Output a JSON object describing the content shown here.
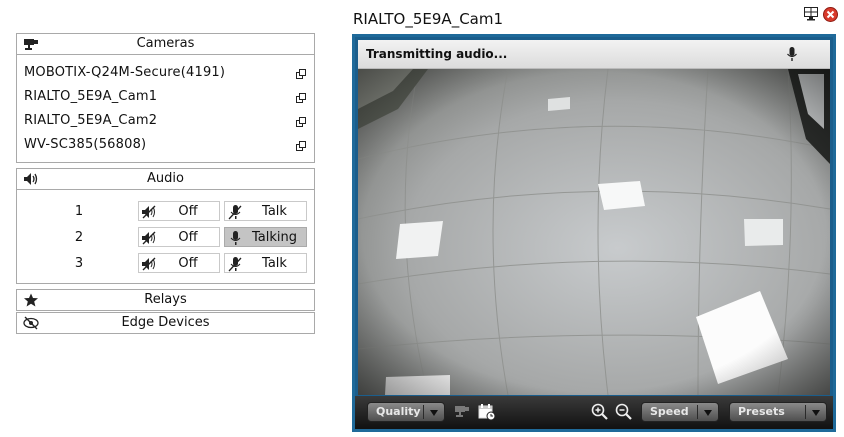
{
  "title": "RIALTO_5E9A_Cam1",
  "cameras": {
    "header": "Cameras",
    "items": [
      "MOBOTIX-Q24M-Secure(4191)",
      "RIALTO_5E9A_Cam1",
      "RIALTO_5E9A_Cam2",
      "WV-SC385(56808)"
    ]
  },
  "audio": {
    "header": "Audio",
    "rows": [
      {
        "num": "1",
        "off_label": "Off",
        "talk_label": "Talk"
      },
      {
        "num": "2",
        "off_label": "Off",
        "talk_label": "Talking"
      },
      {
        "num": "3",
        "off_label": "Off",
        "talk_label": "Talk"
      }
    ]
  },
  "relays": {
    "header": "Relays"
  },
  "edge_devices": {
    "header": "Edge Devices"
  },
  "viewer": {
    "status_text": "Transmitting audio...",
    "controls": {
      "quality_label": "Quality",
      "speed_label": "Speed",
      "presets_label": "Presets"
    }
  },
  "colors": {
    "frame": "#1f6a9a",
    "active_button": "#c4c4c4"
  },
  "icons": [
    "layout-icon",
    "close-icon",
    "camera-icon",
    "speaker-icon",
    "star-icon",
    "edge-devices-icon",
    "popout-icon",
    "speaker-mute-icon",
    "mic-mute-icon",
    "mic-icon",
    "calendar-clock-icon",
    "zoom-in-icon",
    "zoom-out-icon"
  ]
}
